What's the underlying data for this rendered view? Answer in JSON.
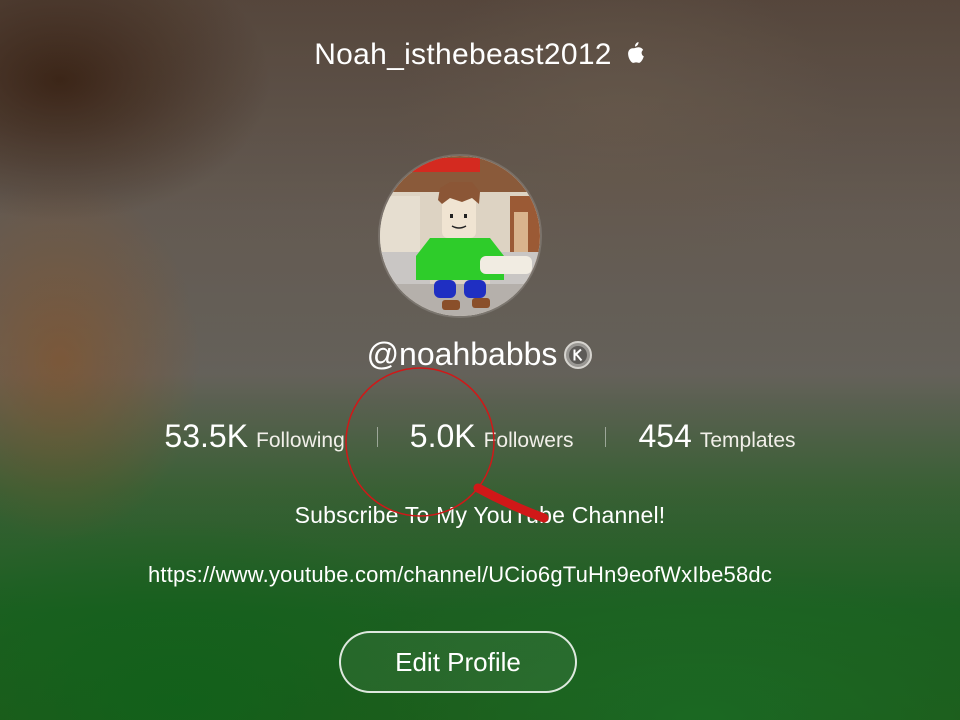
{
  "header": {
    "title": "Noah_isthebeast2012",
    "title_icon": "apple-icon"
  },
  "profile": {
    "avatar_icon": "roblox-avatar",
    "handle": "@noahbabbs",
    "handle_badge_icon": "k-badge-icon"
  },
  "stats": [
    {
      "value": "53.5K",
      "label": "Following"
    },
    {
      "value": "5.0K",
      "label": "Followers"
    },
    {
      "value": "454",
      "label": "Templates"
    }
  ],
  "bio": {
    "text": "Subscribe To My YouTube Channel!",
    "link": "https://www.youtube.com/channel/UCio6gTuHn9eofWxIbe58dc"
  },
  "actions": {
    "edit_profile_label": "Edit Profile"
  },
  "annotation": {
    "color": "#e01a1a"
  },
  "colors": {
    "text": "#ffffff",
    "button_border": "#ffffff"
  }
}
